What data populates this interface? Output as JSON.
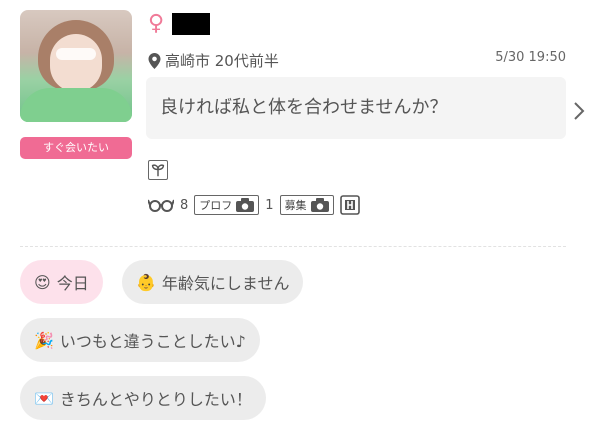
{
  "profile": {
    "gender_symbol": "♀",
    "location": "高崎市 20代前半",
    "timestamp": "5/30 19:50",
    "message": "良ければ私と体を合わせませんか？",
    "want_badge": "すぐ会いたい",
    "glasses_count": "8",
    "profile_tag_label": "プロフ",
    "profile_photo_count": "1",
    "recruit_tag_label": "募集"
  },
  "tags": [
    {
      "emoji": "😍",
      "label": "今日"
    },
    {
      "emoji": "👶",
      "label": "年齢気にしません"
    },
    {
      "emoji": "🎉",
      "label": "いつもと違うことしたい♪"
    },
    {
      "emoji": "💌",
      "label": "きちんとやりとりしたい！"
    }
  ],
  "colors": {
    "accent_pink": "#f06b94",
    "gender_pink": "#f07a98",
    "today_tag_bg": "#fde1eb",
    "tag_bg": "#ececec"
  },
  "icons": [
    "map-pin-icon",
    "chevron-right-icon",
    "sprout-icon",
    "glasses-icon",
    "camera-icon",
    "hotel-icon"
  ]
}
